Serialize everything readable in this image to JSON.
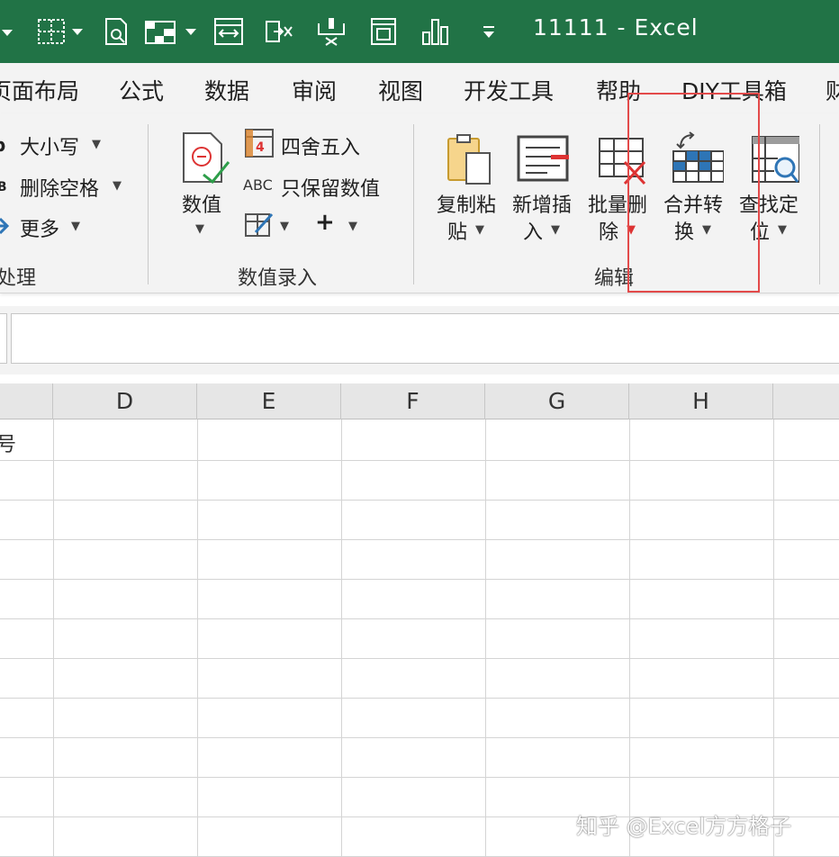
{
  "window": {
    "title": "11111  -  Excel"
  },
  "quick_access": [
    {
      "icon": "border-icon"
    },
    {
      "icon": "print-preview-icon"
    },
    {
      "icon": "table-format-icon"
    },
    {
      "icon": "fit-columns-icon"
    },
    {
      "icon": "export-icon"
    },
    {
      "icon": "merge-cells-icon"
    },
    {
      "icon": "form-icon"
    },
    {
      "icon": "chart-icon"
    },
    {
      "icon": "customize-qat-icon"
    }
  ],
  "tabs": [
    "页面布局",
    "公式",
    "数据",
    "审阅",
    "视图",
    "开发工具",
    "帮助",
    "DIY工具箱",
    "财"
  ],
  "ribbon": {
    "text_group": {
      "items": [
        "大小写",
        "删除空格",
        "更多"
      ],
      "label": "处理"
    },
    "number_group": {
      "value_button": "数值",
      "round_label": "四舍五入",
      "keep_value_label": "只保留数值",
      "abc_glyph": "ABC",
      "plus_glyph": "+",
      "label": "数值录入"
    },
    "edit_group": {
      "buttons": [
        {
          "line1": "复制粘",
          "line2": "贴"
        },
        {
          "line1": "新增插",
          "line2": "入"
        },
        {
          "line1": "批量删",
          "line2": "除"
        },
        {
          "line1": "合并转",
          "line2": "换"
        },
        {
          "line1": "查找定",
          "line2": "位"
        }
      ],
      "label": "编辑"
    }
  },
  "formula_bar": {
    "value": ""
  },
  "grid": {
    "columns": [
      "D",
      "E",
      "F",
      "G",
      "H"
    ],
    "partial_cell_text": "号"
  },
  "watermark": "知乎 @Excel方方格子",
  "colors": {
    "excel_green": "#217346",
    "highlight": "#e34a4a",
    "accent_blue": "#2e75b6"
  }
}
